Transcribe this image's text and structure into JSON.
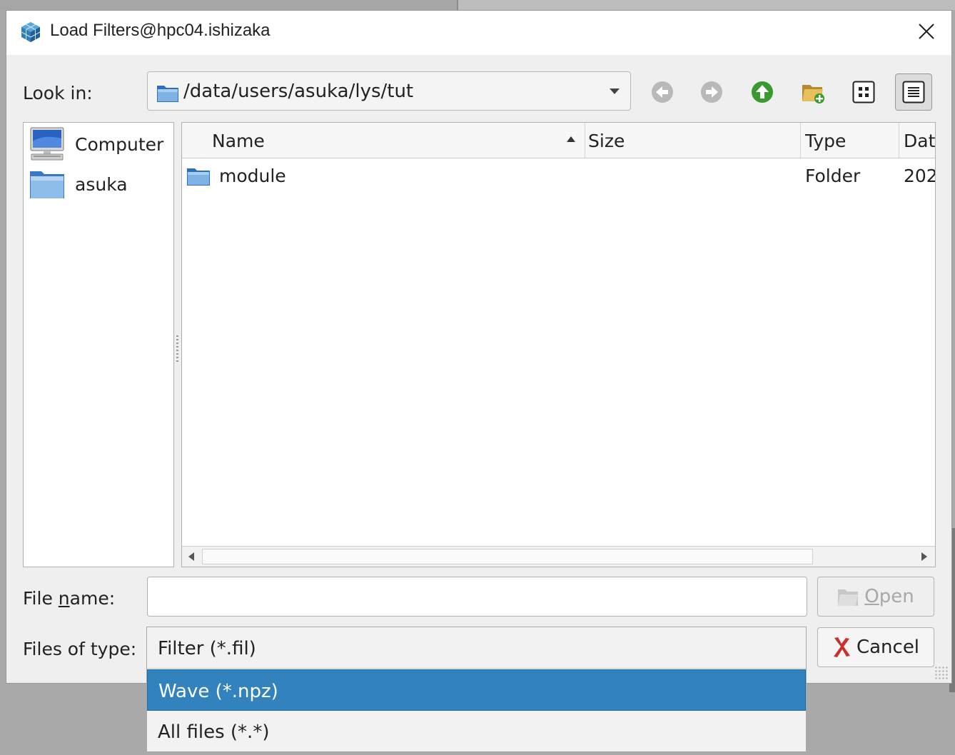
{
  "window": {
    "title": "Load Filters@hpc04.ishizaka",
    "icon": "cube-app-icon"
  },
  "lookin": {
    "label": "Look in:",
    "path": "/data/users/asuka/lys/tut"
  },
  "toolbar": {
    "buttons": [
      "back-icon",
      "forward-icon",
      "parent-directory-icon",
      "new-folder-icon",
      "list-view-icon",
      "detail-view-icon"
    ]
  },
  "sidebar": {
    "items": [
      {
        "label": "Computer",
        "icon": "computer-icon"
      },
      {
        "label": "asuka",
        "icon": "folder-icon"
      }
    ]
  },
  "filelist": {
    "columns": [
      "Name",
      "Size",
      "Type",
      "Dat"
    ],
    "rows": [
      {
        "name": "module",
        "size": "",
        "type": "Folder",
        "date": "202"
      }
    ]
  },
  "filename": {
    "label_pre": "File ",
    "label_mnemonic": "n",
    "label_post": "ame:",
    "value": ""
  },
  "filetype": {
    "label": "Files of type:",
    "options": [
      "Filter (*.fil)",
      "Wave (*.npz)",
      "All files (*.*)"
    ],
    "highlighted_index": 1
  },
  "buttons": {
    "open_pre": "",
    "open_mnemonic": "O",
    "open_post": "pen",
    "cancel": "Cancel"
  },
  "colors": {
    "selection": "#3182bd",
    "folder": "#3a7bc8"
  }
}
